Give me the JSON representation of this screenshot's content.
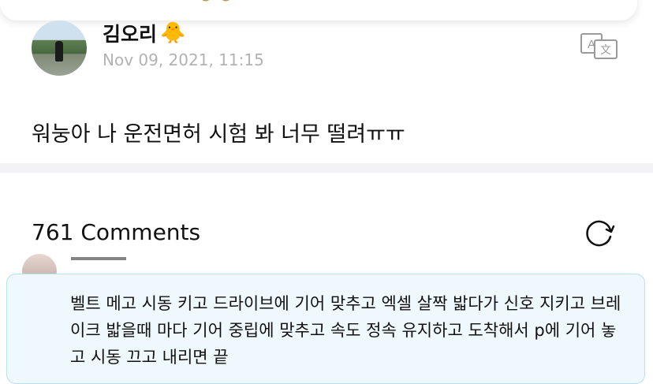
{
  "post": {
    "author_name": "김오리",
    "author_emoji": "🐥",
    "timestamp": "Nov 09, 2021, 11:15",
    "text": "워눙아 나 운전면허 시험 봐 너무 떨려ㅠㅠ"
  },
  "comments": {
    "count_label": "761 Comments",
    "items": [
      {
        "text": "벨트 메고 시동 키고 드라이브에 기어 맞추고 엑셀 살짝 밟다가 신호 지키고 브레이크 밟을때 마다 기어 중립에 맞추고 속도 정속 유지하고 도착해서 p에 기어 놓고 시동 끄고 내리면 끝"
      }
    ]
  },
  "icons": {
    "translate": "translate-icon",
    "refresh": "refresh-icon",
    "chick": "chick-emoji"
  },
  "colors": {
    "highlight_bg": "#eef8fd",
    "highlight_border": "#b7e1f4",
    "timestamp": "#b2b2b2"
  }
}
